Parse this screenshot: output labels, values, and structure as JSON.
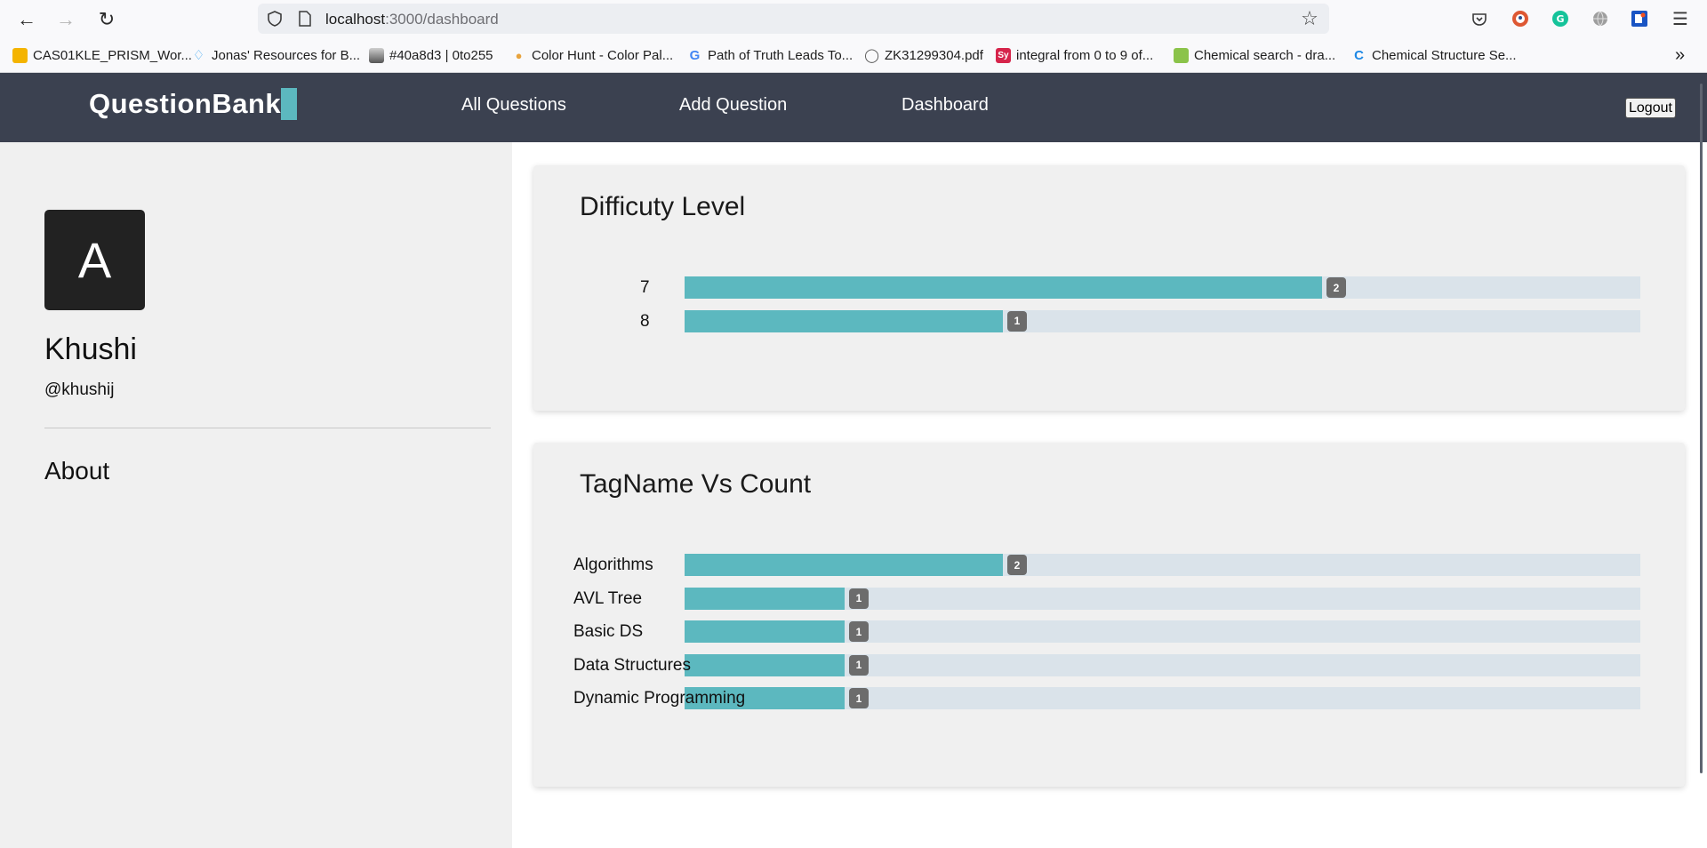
{
  "browser": {
    "url_host": "localhost",
    "url_path": ":3000/dashboard",
    "bookmarks": [
      {
        "label": "CAS01KLE_PRISM_Wor...",
        "icon": "slides-icon",
        "color": "#f4b400"
      },
      {
        "label": "Jonas' Resources for B...",
        "icon": "diamond-icon",
        "color": "#38a3f1"
      },
      {
        "label": "#40a8d3 | 0to255",
        "icon": "gradient-icon",
        "color": "#888888"
      },
      {
        "label": "Color Hunt - Color Pal...",
        "icon": "colorhunt-icon",
        "color": "#e8a33d"
      },
      {
        "label": "Path of Truth Leads To...",
        "icon": "google-icon",
        "color": "#4285f4"
      },
      {
        "label": "ZK31299304.pdf",
        "icon": "globe-icon",
        "color": "#555555"
      },
      {
        "label": "integral from 0 to 9 of...",
        "icon": "symbolab-icon",
        "color": "#d6244b"
      },
      {
        "label": "Chemical search - dra...",
        "icon": "chemspider-icon",
        "color": "#8bc34a"
      },
      {
        "label": "Chemical Structure Se...",
        "icon": "chemstructure-icon",
        "color": "#1e88e5"
      }
    ]
  },
  "header": {
    "brand": "QuestionBank",
    "nav": [
      "All Questions",
      "Add Question",
      "Dashboard"
    ],
    "logout_label": "Logout",
    "accent": "#5cb8bf",
    "background": "#3b4150"
  },
  "profile": {
    "avatar_letter": "A",
    "name": "Khushi",
    "handle": "@khushij",
    "about_heading": "About"
  },
  "chart_data": [
    {
      "type": "bar",
      "orientation": "horizontal",
      "title": "Difficuty Level",
      "categories": [
        "7",
        "8"
      ],
      "values": [
        2,
        1
      ],
      "value_labels": [
        "2",
        "1"
      ],
      "max_bar_fraction": [
        0.667,
        0.333
      ],
      "bar_color": "#5cb8bf",
      "track_color": "#dae3ea"
    },
    {
      "type": "bar",
      "orientation": "horizontal",
      "title": "TagName Vs Count",
      "categories": [
        "Algorithms",
        "AVL Tree",
        "Basic DS",
        "Data Structures",
        "Dynamic Programming"
      ],
      "values": [
        2,
        1,
        1,
        1,
        1
      ],
      "value_labels": [
        "2",
        "1",
        "1",
        "1",
        "1"
      ],
      "max_bar_fraction": [
        0.333,
        0.167,
        0.167,
        0.167,
        0.167
      ],
      "bar_color": "#5cb8bf",
      "track_color": "#dae3ea"
    }
  ]
}
